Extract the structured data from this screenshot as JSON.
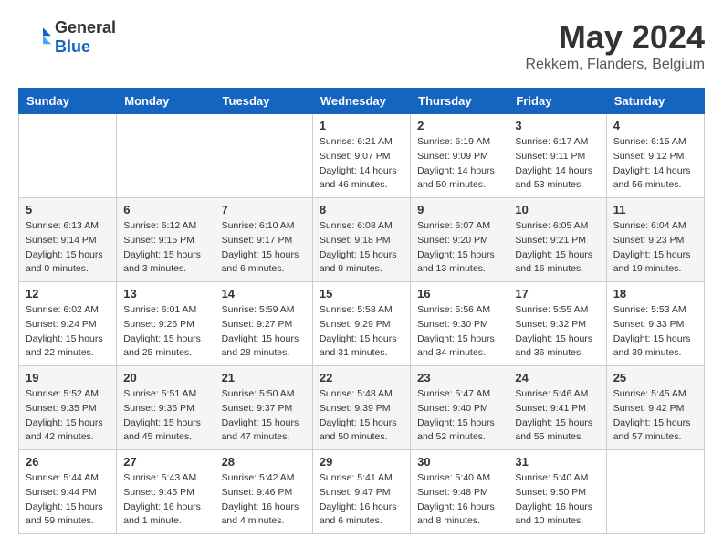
{
  "header": {
    "logo_general": "General",
    "logo_blue": "Blue",
    "month_title": "May 2024",
    "location": "Rekkem, Flanders, Belgium"
  },
  "days_of_week": [
    "Sunday",
    "Monday",
    "Tuesday",
    "Wednesday",
    "Thursday",
    "Friday",
    "Saturday"
  ],
  "weeks": [
    [
      {
        "day": "",
        "info": ""
      },
      {
        "day": "",
        "info": ""
      },
      {
        "day": "",
        "info": ""
      },
      {
        "day": "1",
        "info": "Sunrise: 6:21 AM\nSunset: 9:07 PM\nDaylight: 14 hours\nand 46 minutes."
      },
      {
        "day": "2",
        "info": "Sunrise: 6:19 AM\nSunset: 9:09 PM\nDaylight: 14 hours\nand 50 minutes."
      },
      {
        "day": "3",
        "info": "Sunrise: 6:17 AM\nSunset: 9:11 PM\nDaylight: 14 hours\nand 53 minutes."
      },
      {
        "day": "4",
        "info": "Sunrise: 6:15 AM\nSunset: 9:12 PM\nDaylight: 14 hours\nand 56 minutes."
      }
    ],
    [
      {
        "day": "5",
        "info": "Sunrise: 6:13 AM\nSunset: 9:14 PM\nDaylight: 15 hours\nand 0 minutes."
      },
      {
        "day": "6",
        "info": "Sunrise: 6:12 AM\nSunset: 9:15 PM\nDaylight: 15 hours\nand 3 minutes."
      },
      {
        "day": "7",
        "info": "Sunrise: 6:10 AM\nSunset: 9:17 PM\nDaylight: 15 hours\nand 6 minutes."
      },
      {
        "day": "8",
        "info": "Sunrise: 6:08 AM\nSunset: 9:18 PM\nDaylight: 15 hours\nand 9 minutes."
      },
      {
        "day": "9",
        "info": "Sunrise: 6:07 AM\nSunset: 9:20 PM\nDaylight: 15 hours\nand 13 minutes."
      },
      {
        "day": "10",
        "info": "Sunrise: 6:05 AM\nSunset: 9:21 PM\nDaylight: 15 hours\nand 16 minutes."
      },
      {
        "day": "11",
        "info": "Sunrise: 6:04 AM\nSunset: 9:23 PM\nDaylight: 15 hours\nand 19 minutes."
      }
    ],
    [
      {
        "day": "12",
        "info": "Sunrise: 6:02 AM\nSunset: 9:24 PM\nDaylight: 15 hours\nand 22 minutes."
      },
      {
        "day": "13",
        "info": "Sunrise: 6:01 AM\nSunset: 9:26 PM\nDaylight: 15 hours\nand 25 minutes."
      },
      {
        "day": "14",
        "info": "Sunrise: 5:59 AM\nSunset: 9:27 PM\nDaylight: 15 hours\nand 28 minutes."
      },
      {
        "day": "15",
        "info": "Sunrise: 5:58 AM\nSunset: 9:29 PM\nDaylight: 15 hours\nand 31 minutes."
      },
      {
        "day": "16",
        "info": "Sunrise: 5:56 AM\nSunset: 9:30 PM\nDaylight: 15 hours\nand 34 minutes."
      },
      {
        "day": "17",
        "info": "Sunrise: 5:55 AM\nSunset: 9:32 PM\nDaylight: 15 hours\nand 36 minutes."
      },
      {
        "day": "18",
        "info": "Sunrise: 5:53 AM\nSunset: 9:33 PM\nDaylight: 15 hours\nand 39 minutes."
      }
    ],
    [
      {
        "day": "19",
        "info": "Sunrise: 5:52 AM\nSunset: 9:35 PM\nDaylight: 15 hours\nand 42 minutes."
      },
      {
        "day": "20",
        "info": "Sunrise: 5:51 AM\nSunset: 9:36 PM\nDaylight: 15 hours\nand 45 minutes."
      },
      {
        "day": "21",
        "info": "Sunrise: 5:50 AM\nSunset: 9:37 PM\nDaylight: 15 hours\nand 47 minutes."
      },
      {
        "day": "22",
        "info": "Sunrise: 5:48 AM\nSunset: 9:39 PM\nDaylight: 15 hours\nand 50 minutes."
      },
      {
        "day": "23",
        "info": "Sunrise: 5:47 AM\nSunset: 9:40 PM\nDaylight: 15 hours\nand 52 minutes."
      },
      {
        "day": "24",
        "info": "Sunrise: 5:46 AM\nSunset: 9:41 PM\nDaylight: 15 hours\nand 55 minutes."
      },
      {
        "day": "25",
        "info": "Sunrise: 5:45 AM\nSunset: 9:42 PM\nDaylight: 15 hours\nand 57 minutes."
      }
    ],
    [
      {
        "day": "26",
        "info": "Sunrise: 5:44 AM\nSunset: 9:44 PM\nDaylight: 15 hours\nand 59 minutes."
      },
      {
        "day": "27",
        "info": "Sunrise: 5:43 AM\nSunset: 9:45 PM\nDaylight: 16 hours\nand 1 minute."
      },
      {
        "day": "28",
        "info": "Sunrise: 5:42 AM\nSunset: 9:46 PM\nDaylight: 16 hours\nand 4 minutes."
      },
      {
        "day": "29",
        "info": "Sunrise: 5:41 AM\nSunset: 9:47 PM\nDaylight: 16 hours\nand 6 minutes."
      },
      {
        "day": "30",
        "info": "Sunrise: 5:40 AM\nSunset: 9:48 PM\nDaylight: 16 hours\nand 8 minutes."
      },
      {
        "day": "31",
        "info": "Sunrise: 5:40 AM\nSunset: 9:50 PM\nDaylight: 16 hours\nand 10 minutes."
      },
      {
        "day": "",
        "info": ""
      }
    ]
  ]
}
